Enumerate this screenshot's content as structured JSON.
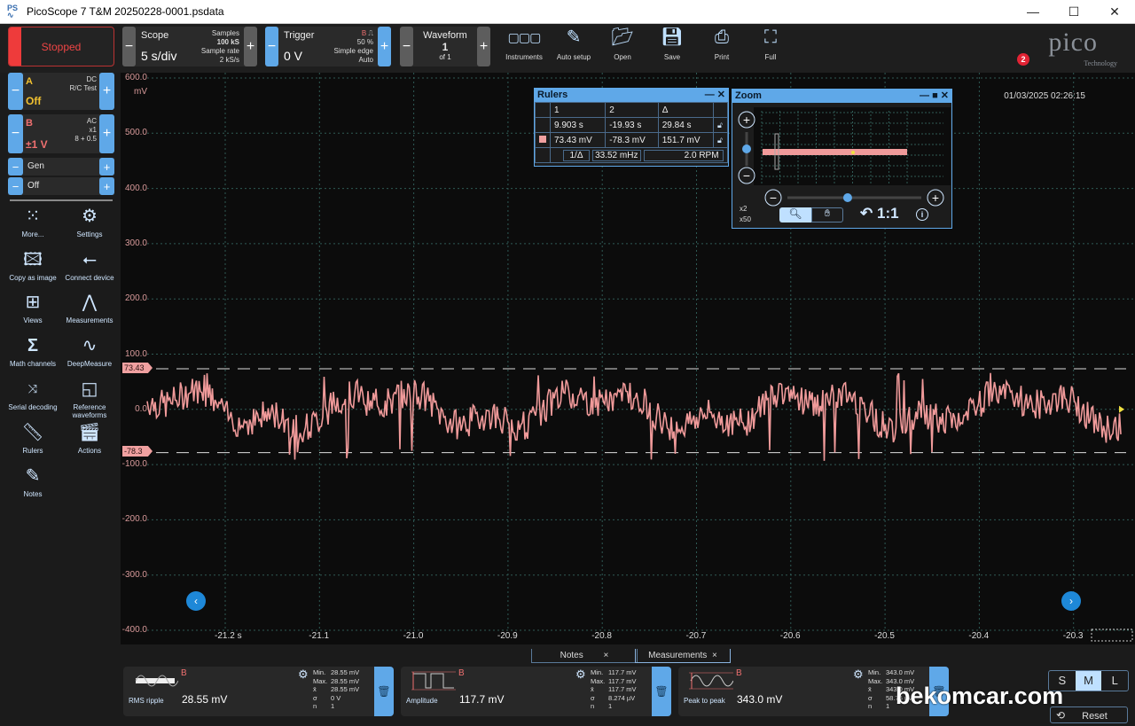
{
  "window": {
    "title": "PicoScope 7 T&M 20250228-0001.psdata",
    "controls": {
      "minimize": "—",
      "maximize": "☐",
      "close": "✕"
    }
  },
  "toolbar": {
    "status": "Stopped",
    "scope": {
      "label": "Scope",
      "value": "5 s/div",
      "samples_label": "Samples",
      "samples": "100 kS",
      "rate_label": "Sample rate",
      "rate": "2 kS/s"
    },
    "trigger": {
      "label": "Trigger",
      "value": "0 V",
      "channel": "B",
      "edge_icon": "rising-edge-icon",
      "percent": "50 %",
      "type": "Simple edge",
      "mode": "Auto"
    },
    "waveform": {
      "label": "Waveform",
      "value": "1",
      "of": "of 1"
    },
    "buttons": [
      {
        "label": "Instruments",
        "icon": "instruments-icon"
      },
      {
        "label": "Auto setup",
        "icon": "auto-setup-icon"
      },
      {
        "label": "Open",
        "icon": "folder-icon"
      },
      {
        "label": "Save",
        "icon": "save-icon"
      },
      {
        "label": "Print",
        "icon": "printer-icon"
      },
      {
        "label": "Full",
        "icon": "fullscreen-icon"
      }
    ],
    "logo": {
      "name": "pico",
      "sub": "Technology"
    },
    "notification_count": "2"
  },
  "sidebar": {
    "channel_a": {
      "name": "A",
      "coupling": "DC",
      "probe": "R/C Test",
      "range": "Off",
      "color": "#f0c030"
    },
    "channel_b": {
      "name": "B",
      "coupling": "AC",
      "probe": "x1",
      "filter": "8 + 0.5",
      "range": "±1 V",
      "color": "#f07070"
    },
    "gen": {
      "label": "Gen",
      "state": "Off"
    },
    "tools": [
      {
        "label": "More...",
        "icon": "grid-dots-icon"
      },
      {
        "label": "Settings",
        "icon": "gear-icon"
      },
      {
        "label": "Copy as image",
        "icon": "image-icon"
      },
      {
        "label": "Connect device",
        "icon": "usb-icon"
      },
      {
        "label": "Views",
        "icon": "views-grid-icon"
      },
      {
        "label": "Measurements",
        "icon": "compass-icon"
      },
      {
        "label": "Math channels",
        "icon": "sigma-icon"
      },
      {
        "label": "DeepMeasure",
        "icon": "deepmeasure-icon"
      },
      {
        "label": "Serial decoding",
        "icon": "serial-decoding-icon"
      },
      {
        "label": "Reference waveforms",
        "icon": "reference-waveform-icon"
      },
      {
        "label": "Rulers",
        "icon": "ruler-icon"
      },
      {
        "label": "Actions",
        "icon": "clapperboard-icon"
      },
      {
        "label": "Notes",
        "icon": "notes-icon"
      }
    ]
  },
  "plot": {
    "datetime": "01/03/2025 02:26:15",
    "y_unit": "mV",
    "y_ticks": [
      "600.0",
      "500.0",
      "400.0",
      "300.0",
      "200.0",
      "100.0",
      "0.0",
      "-100.0",
      "-200.0",
      "-300.0",
      "-400.0"
    ],
    "x_ticks": [
      "-21.2 s",
      "-21.1",
      "-21.0",
      "-20.9",
      "-20.8",
      "-20.7",
      "-20.6",
      "-20.5",
      "-20.4",
      "-20.3"
    ],
    "ruler_flags": [
      "73.43",
      "-78.3"
    ],
    "trace_color": "#f09a9a",
    "nav_left": "‹",
    "nav_right": "›"
  },
  "rulers": {
    "title": "Rulers",
    "headers": [
      "1",
      "2",
      "Δ"
    ],
    "time_row": [
      "9.903 s",
      "-19.93 s",
      "29.84 s"
    ],
    "voltage_row": [
      "73.43 mV",
      "-78.3 mV",
      "151.7 mV"
    ],
    "freq_label": "1/Δ",
    "freq": "33.52 mHz",
    "rpm": "2.0 RPM"
  },
  "zoom": {
    "title": "Zoom",
    "x_zoom": "x2",
    "y_zoom": "x50",
    "ratio": "1:1",
    "vertical_zoom_level": 0.5,
    "horizontal_zoom_level": 0.45
  },
  "tabs": [
    {
      "label": "Notes",
      "close": "×"
    },
    {
      "label": "Measurements",
      "close": "×"
    }
  ],
  "measurements": [
    {
      "channel": "B",
      "name": "RMS ripple",
      "value": "28.55 mV",
      "min": "28.55 mV",
      "max": "28.55 mV",
      "mean": "28.55 mV",
      "sigma": "0 V",
      "n": "1"
    },
    {
      "channel": "B",
      "name": "Amplitude",
      "value": "117.7 mV",
      "min": "117.7 mV",
      "max": "117.7 mV",
      "mean": "117.7 mV",
      "sigma": "8.274 µV",
      "n": "1"
    },
    {
      "channel": "B",
      "name": "Peak to peak",
      "value": "343.0 mV",
      "min": "343.0 mV",
      "max": "343.0 mV",
      "mean": "343.0 mV",
      "sigma": "58.76 µV",
      "n": "1"
    }
  ],
  "stat_labels": {
    "min": "Min.",
    "max": "Max.",
    "mean": "x̄",
    "sigma": "σ",
    "n": "n"
  },
  "size_selector": {
    "options": [
      "S",
      "M",
      "L"
    ],
    "selected": "M"
  },
  "reset_label": "Reset",
  "watermark": "bekomcar.com"
}
